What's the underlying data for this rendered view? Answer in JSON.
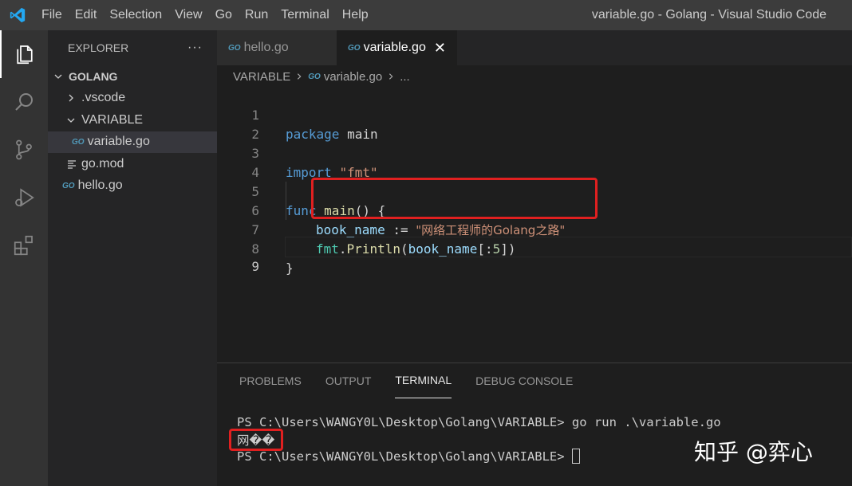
{
  "menu": {
    "items": [
      "File",
      "Edit",
      "Selection",
      "View",
      "Go",
      "Run",
      "Terminal",
      "Help"
    ]
  },
  "window": {
    "title": "variable.go - Golang - Visual Studio Code"
  },
  "activity_bar": {
    "icons": [
      "explorer-icon",
      "search-icon",
      "source-control-icon",
      "run-debug-icon",
      "extensions-icon"
    ]
  },
  "sidebar": {
    "header": "EXPLORER",
    "more": "···",
    "root": "GOLANG",
    "items": [
      {
        "label": ".vscode",
        "type": "folder-collapsed"
      },
      {
        "label": "VARIABLE",
        "type": "folder-expanded"
      },
      {
        "label": "variable.go",
        "type": "go-file",
        "selected": true
      },
      {
        "label": "go.mod",
        "type": "mod-file"
      },
      {
        "label": "hello.go",
        "type": "go-file"
      }
    ]
  },
  "tabs": [
    {
      "label": "hello.go",
      "active": false
    },
    {
      "label": "variable.go",
      "active": true,
      "close": "✕"
    }
  ],
  "go_badge": "GO",
  "breadcrumb": {
    "folder": "VARIABLE",
    "file": "variable.go",
    "ellipsis": "..."
  },
  "editor": {
    "line_numbers": [
      "1",
      "2",
      "3",
      "4",
      "5",
      "6",
      "7",
      "8",
      "9"
    ],
    "tokens": {
      "l1_kw": "package",
      "l1_name": " main",
      "l3_kw": "import",
      "l3_str": "\"fmt\"",
      "l5_kw": "func",
      "l5_fn": "main",
      "l5_rest": "() {",
      "l6_var": "book_name",
      "l6_op": " := ",
      "l6_str": "\"网络工程师的Golang之路\"",
      "l7_pkg": "fmt",
      "l7_dot": ".",
      "l7_fn": "Println",
      "l7_open": "(",
      "l7_arg": "book_name",
      "l7_open2": "[:",
      "l7_num": "5",
      "l7_close": "])",
      "l8": "}"
    }
  },
  "panel": {
    "tabs": [
      "PROBLEMS",
      "OUTPUT",
      "TERMINAL",
      "DEBUG CONSOLE"
    ],
    "active_tab": "TERMINAL",
    "terminal": {
      "line1": "PS C:\\Users\\WANGY0L\\Desktop\\Golang\\VARIABLE> go run .\\variable.go",
      "output": "网��",
      "line3": "PS C:\\Users\\WANGY0L\\Desktop\\Golang\\VARIABLE> "
    }
  },
  "watermark": "知乎 @弈心"
}
